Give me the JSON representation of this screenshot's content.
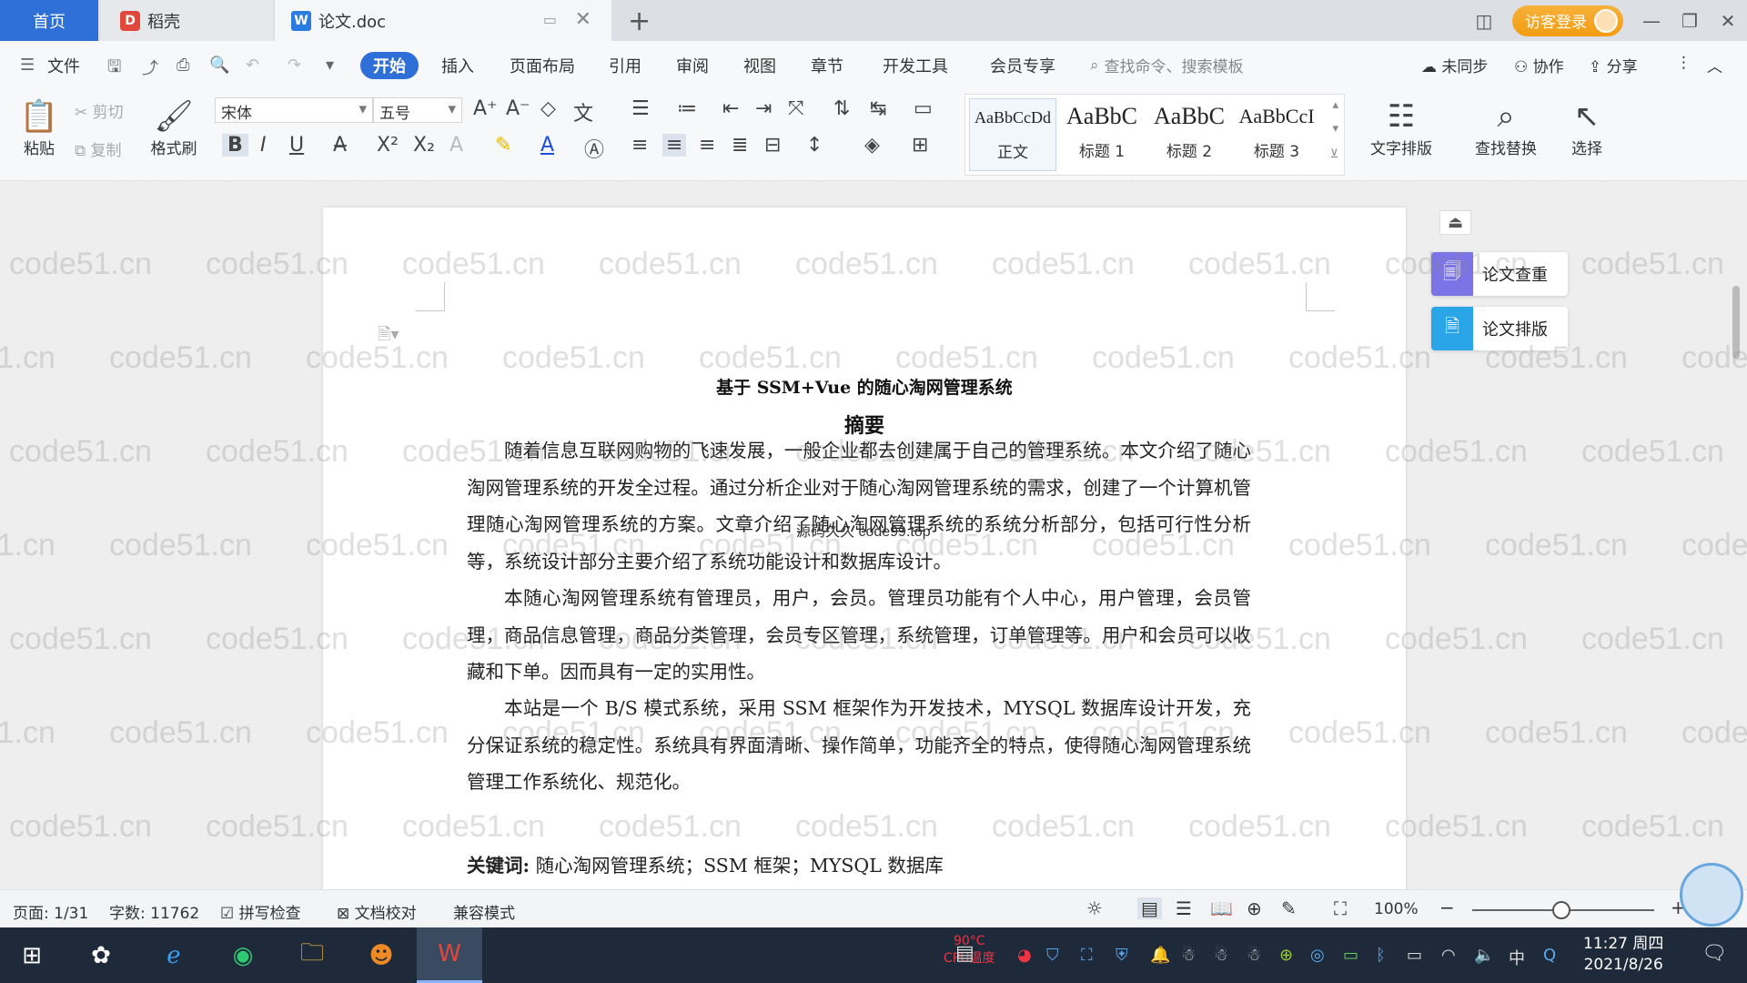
{
  "titlebar": {
    "tabs": [
      {
        "label": "首页"
      },
      {
        "label": "稻壳"
      },
      {
        "label": "论文.doc"
      }
    ],
    "guest_login": "访客登录"
  },
  "menubar": {
    "file": "文件",
    "tabs": [
      "开始",
      "插入",
      "页面布局",
      "引用",
      "审阅",
      "视图",
      "章节",
      "开发工具",
      "会员专享"
    ],
    "search_placeholder": "查找命令、搜索模板",
    "sync": "未同步",
    "collab": "协作",
    "share": "分享"
  },
  "ribbon": {
    "paste": "粘贴",
    "cut": "剪切",
    "copy": "复制",
    "format_painter": "格式刷",
    "font_name": "宋体",
    "font_size": "五号",
    "styles": [
      {
        "sample": "AaBbCcDd",
        "label": "正文"
      },
      {
        "sample": "AaBbC",
        "label": "标题 1"
      },
      {
        "sample": "AaBbC",
        "label": "标题 2"
      },
      {
        "sample": "AaBbCcI",
        "label": "标题 3"
      }
    ],
    "text_layout": "文字排版",
    "find_replace": "查找替换",
    "select": "选择"
  },
  "document": {
    "title": "基于 SSM+Vue 的随心淘网管理系统",
    "abstract_heading": "摘要",
    "paragraphs": [
      "随着信息互联网购物的飞速发展，一般企业都去创建属于自己的管理系统。本文介绍了随心淘网管理系统的开发全过程。通过分析企业对于随心淘网管理系统的需求，创建了一个计算机管理随心淘网管理系统的方案。文章介绍了随心淘网管理系统的系统分析部分，包括可行性分析等，系统设计部分主要介绍了系统功能设计和数据库设计。",
      "本随心淘网管理系统有管理员，用户，会员。管理员功能有个人中心，用户管理，会员管理，商品信息管理，商品分类管理，会员专区管理，系统管理，订单管理等。用户和会员可以收藏和下单。因而具有一定的实用性。",
      "本站是一个 B/S 模式系统，采用 SSM 框架作为开发技术，MYSQL 数据库设计开发，充分保证系统的稳定性。系统具有界面清晰、操作简单，功能齐全的特点，使得随心淘网管理系统管理工作系统化、规范化。"
    ],
    "keywords_label": "关键词:",
    "keywords": "随心淘网管理系统；SSM 框架；MYSQL 数据库",
    "overlay": "源码久久 code99.top",
    "watermark": "code51.cn"
  },
  "side_panel": {
    "check": "论文查重",
    "layout": "论文排版"
  },
  "statusbar": {
    "page": "页面: 1/31",
    "words": "字数: 11762",
    "spell": "拼写检查",
    "proof": "文档校对",
    "compat": "兼容模式",
    "zoom": "100%"
  },
  "taskbar": {
    "cpu": "90°C",
    "cpu_label": "CPU温度",
    "time": "11:27 周四",
    "date": "2021/8/26",
    "ime": "中"
  },
  "colors": {
    "accent": "#2f6fd8",
    "guest": "#f39c12",
    "check_icon": "#7b74e6",
    "layout_icon": "#2aa6e8"
  }
}
